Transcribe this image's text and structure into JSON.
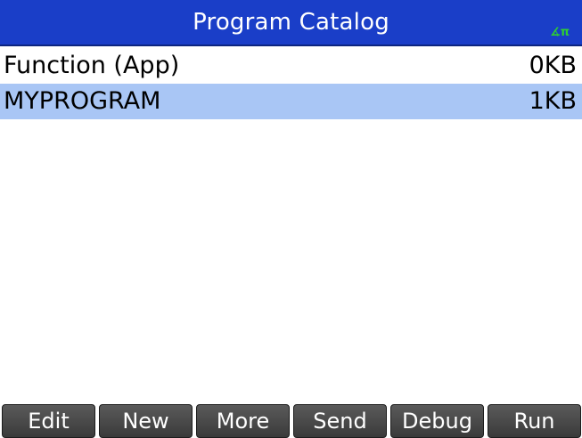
{
  "header": {
    "title": "Program Catalog",
    "angle_indicator": "∡π",
    "title_bar_color": "#1a3ec8",
    "indicator_color": "#2fd02f"
  },
  "programs": [
    {
      "name": "Function (App)",
      "size": "0KB",
      "selected": false
    },
    {
      "name": "MYPROGRAM",
      "size": "1KB",
      "selected": true
    }
  ],
  "selection_color": "#a9c6f5",
  "softkeys": [
    "Edit",
    "New",
    "More",
    "Send",
    "Debug",
    "Run"
  ]
}
